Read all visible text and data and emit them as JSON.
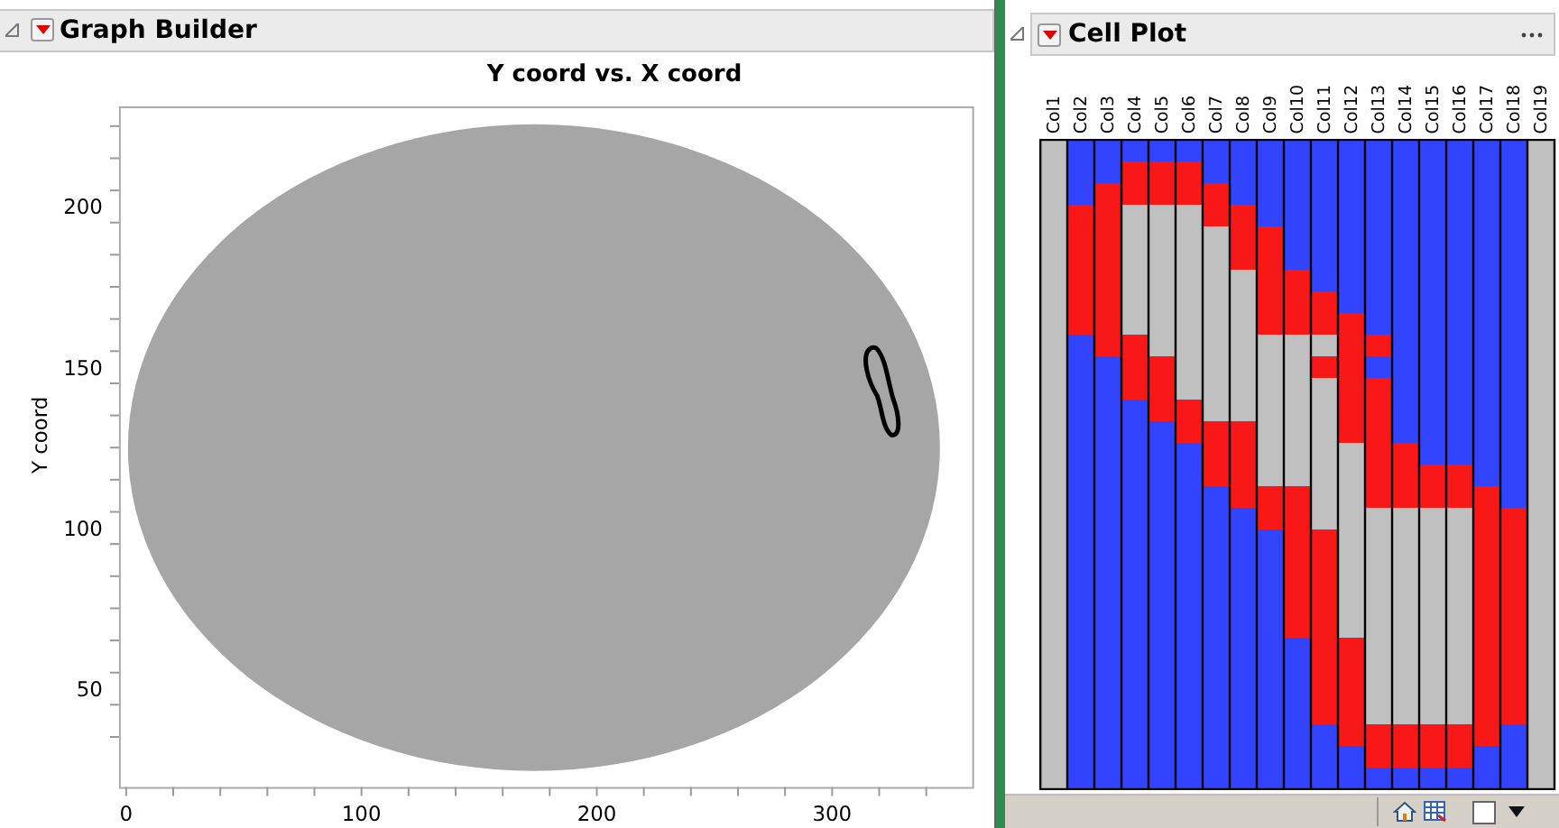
{
  "graph_builder": {
    "title": "Graph Builder",
    "chart_title": "Y coord vs. X coord",
    "y_axis_label": "Y coord",
    "x_ticks": [
      "0",
      "100",
      "200",
      "300"
    ],
    "y_ticks": [
      "200",
      "150",
      "100",
      "50"
    ]
  },
  "cell_plot": {
    "title": "Cell Plot",
    "checkbox": {
      "checked": false
    },
    "columns": [
      "Col1",
      "Col2",
      "Col3",
      "Col4",
      "Col5",
      "Col6",
      "Col7",
      "Col8",
      "Col9",
      "Col10",
      "Col11",
      "Col12",
      "Col13",
      "Col14",
      "Col15",
      "Col16",
      "Col17",
      "Col18",
      "Col19"
    ]
  }
}
